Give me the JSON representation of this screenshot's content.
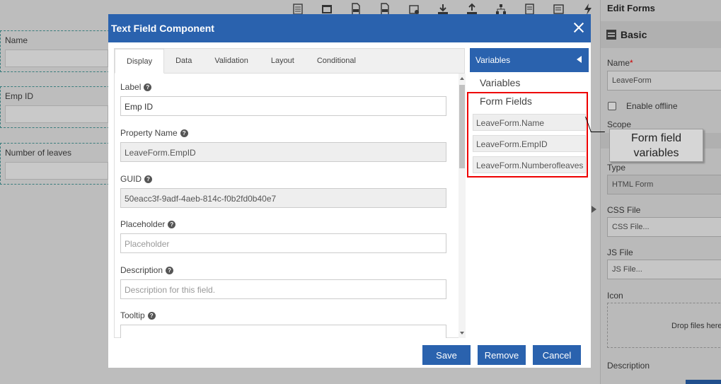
{
  "canvas": {
    "fields": [
      {
        "label": "Name"
      },
      {
        "label": "Emp ID"
      },
      {
        "label": "Number of leaves"
      }
    ],
    "toolbar_icons": [
      "grid-icon",
      "window-icon",
      "css-file-icon",
      "js-file-icon",
      "component-icon",
      "download-icon",
      "upload-icon",
      "hierarchy-icon",
      "document-edit-icon",
      "checklist-icon",
      "lightning-icon"
    ]
  },
  "right_panel": {
    "title": "Edit Forms",
    "section": "Basic",
    "name_label": "Name",
    "name_value": "LeaveForm",
    "enable_offline": "Enable offline",
    "scope_label": "Scope",
    "type_label": "Type",
    "type_value": "HTML Form",
    "css_label": "CSS File",
    "css_placeholder": "CSS File...",
    "js_label": "JS File",
    "js_placeholder": "JS File...",
    "icon_label": "Icon",
    "drop_text": "Drop files here",
    "description_label": "Description"
  },
  "modal": {
    "title": "Text Field Component",
    "tabs": [
      "Display",
      "Data",
      "Validation",
      "Layout",
      "Conditional"
    ],
    "fields": {
      "label": {
        "label": "Label",
        "value": "Emp ID"
      },
      "property_name": {
        "label": "Property Name",
        "value": "LeaveForm.EmpID"
      },
      "guid": {
        "label": "GUID",
        "value": "50eacc3f-9adf-4aeb-814c-f0b2fd0b40e7"
      },
      "placeholder": {
        "label": "Placeholder",
        "placeholder": "Placeholder"
      },
      "description": {
        "label": "Description",
        "placeholder": "Description for this field."
      },
      "tooltip": {
        "label": "Tooltip"
      }
    },
    "variables": {
      "header": "Variables",
      "tab_variables": "Variables",
      "tab_form_fields": "Form Fields",
      "items": [
        "LeaveForm.Name",
        "LeaveForm.EmpID",
        "LeaveForm.Numberofleaves"
      ]
    },
    "buttons": {
      "save": "Save",
      "remove": "Remove",
      "cancel": "Cancel"
    }
  },
  "annotation": {
    "text_line1": "Form field",
    "text_line2": "variables"
  },
  "colors": {
    "primary": "#2a62ae",
    "highlight": "#e00000"
  }
}
